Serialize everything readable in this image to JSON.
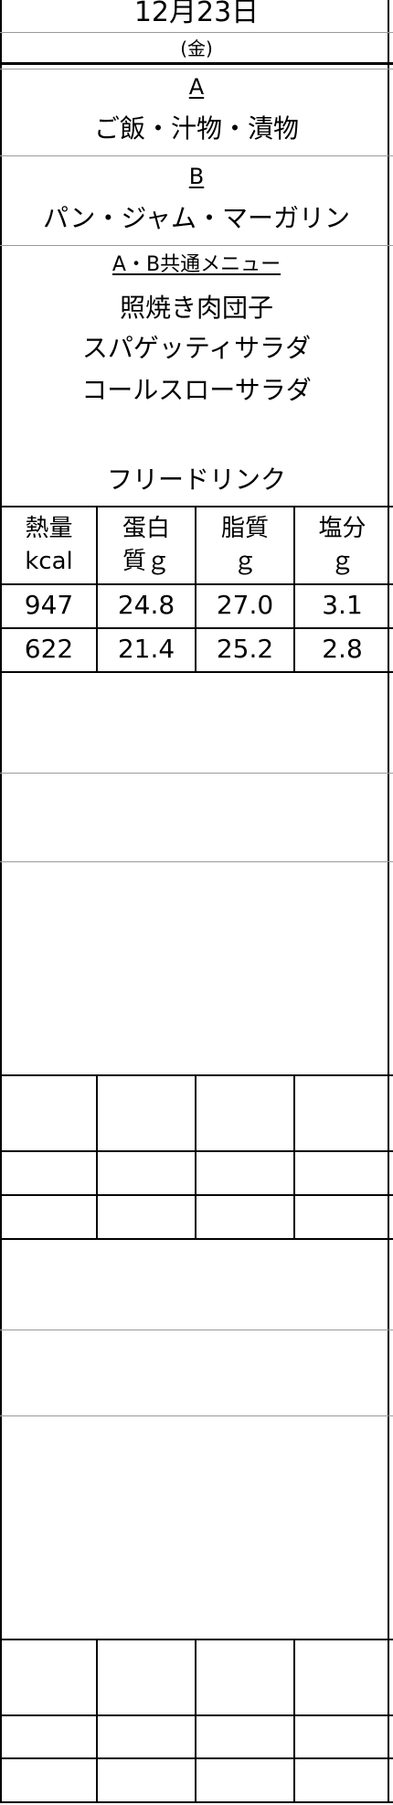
{
  "header": {
    "date": "12月23日",
    "weekday": "(金)"
  },
  "menu": {
    "set_a": {
      "label": "A",
      "items": "ご飯・汁物・漬物"
    },
    "set_b": {
      "label": "B",
      "items": "パン・ジャム・マーガリン"
    },
    "common": {
      "label": "A・B共通メニュー",
      "dishes": [
        "照焼き肉団子",
        "スパゲッティサラダ",
        "コールスローサラダ"
      ],
      "drink": "フリードリンク"
    }
  },
  "nutrition": {
    "headers": [
      {
        "line1": "熱量",
        "line2": "kcal"
      },
      {
        "line1": "蛋白",
        "line2": "質ｇ"
      },
      {
        "line1": "脂質",
        "line2": "ｇ"
      },
      {
        "line1": "塩分",
        "line2": "ｇ"
      }
    ],
    "rows": [
      [
        "947",
        "24.8",
        "27.0",
        "3.1"
      ],
      [
        "622",
        "21.4",
        "25.2",
        "2.8"
      ]
    ]
  }
}
